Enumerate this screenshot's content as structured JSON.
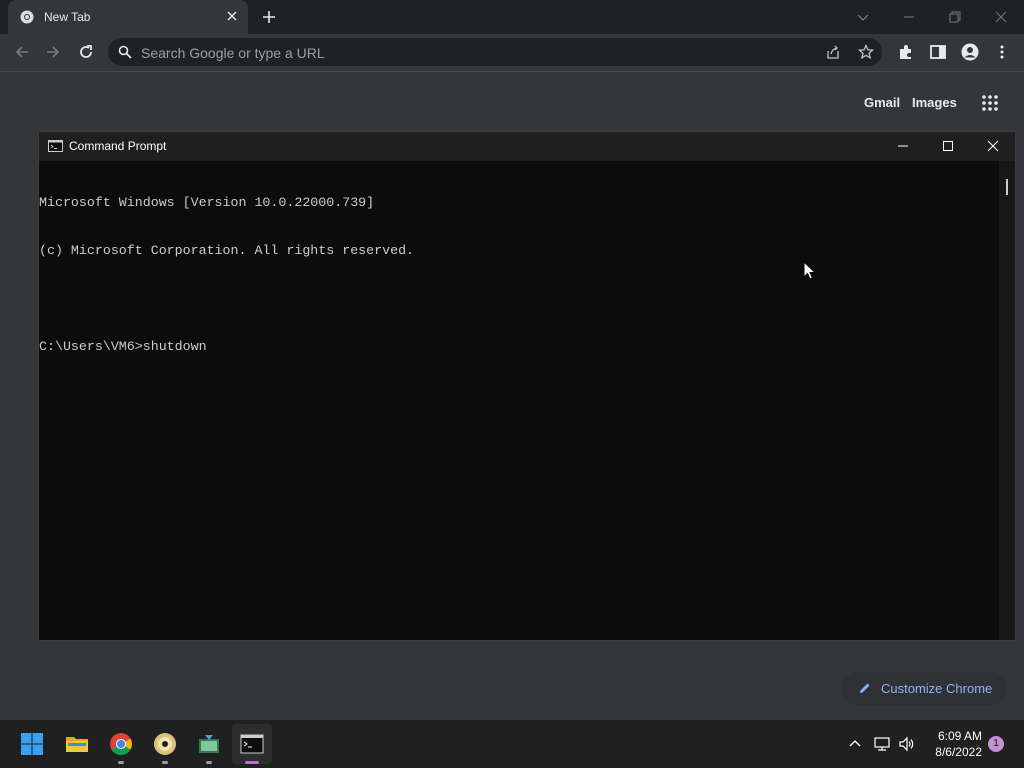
{
  "browser": {
    "tab_title": "New Tab",
    "omnibox_placeholder": "Search Google or type a URL",
    "ntp_links": [
      "Gmail",
      "Images"
    ],
    "customize_label": "Customize Chrome"
  },
  "cmd": {
    "title": "Command Prompt",
    "lines": [
      "Microsoft Windows [Version 10.0.22000.739]",
      "(c) Microsoft Corporation. All rights reserved.",
      "",
      "C:\\Users\\VM6>shutdown"
    ]
  },
  "taskbar": {
    "apps": [
      "start-icon",
      "file-explorer-icon",
      "chrome-icon",
      "disc-icon",
      "app-icon",
      "command-prompt-icon"
    ],
    "active_app": "command-prompt-icon",
    "time": "6:09 AM",
    "date": "8/6/2022",
    "notification_count": "1"
  },
  "colors": {
    "chrome_frame": "#202124",
    "chrome_toolbar": "#35363a",
    "cmd_bg": "#0c0c0c",
    "accent_link": "#8ab4f8",
    "taskbar": "#202020"
  }
}
